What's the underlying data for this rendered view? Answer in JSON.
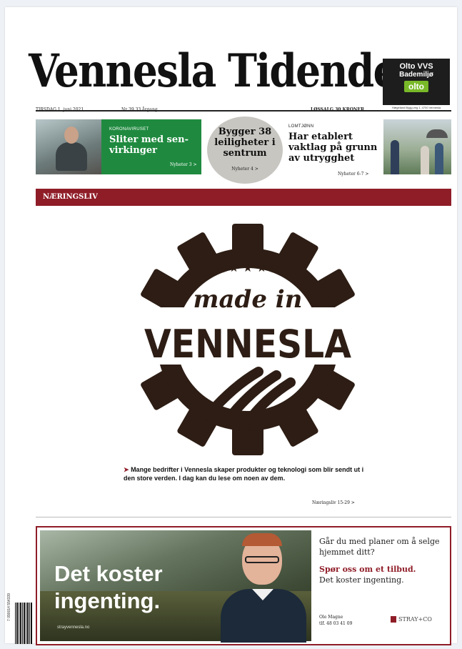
{
  "masthead": {
    "title": "Vennesla Tidende"
  },
  "dateline": {
    "day": "TIRSDAG 1. juni 2021",
    "issue": "Nr 39   33 årgang",
    "price": "LØSSALG 30 KRONER"
  },
  "top_ad": {
    "line1": "Olto VVS",
    "line2": "Bademiljø",
    "brand": "olto",
    "address": "Hægeland Bygg veg 1, 4700 Vennesla"
  },
  "teasers": {
    "left": {
      "kicker": "KORONAVIRUSET",
      "headline": "Sliter med sen-virkinger",
      "ref": "Nyheter 3 >"
    },
    "center": {
      "headline": "Bygger 38 leiligheter i sentrum",
      "ref": "Nyheter 4 >"
    },
    "right": {
      "kicker": "LOMTJØNN",
      "headline": "Har etablert vaktlag på grunn av utrygghet",
      "ref": "Nyheter 6-7 >"
    }
  },
  "section": {
    "label": "NÆRINGSLIV"
  },
  "logo": {
    "script": "made in",
    "word": "VENNESLA"
  },
  "lede": {
    "arrow": "➤",
    "text": "Mange bedrifter i Vennesla skaper produkter og teknologi som blir sendt ut i den store verden. I dag kan du lese om noen av dem.",
    "ref": "Næringsliv 15-29 >"
  },
  "ad": {
    "title_line1": "Det koster",
    "title_line2": "ingenting.",
    "url": "strayvennesla.no",
    "question": "Går du med planer om å selge hjemmet ditt?",
    "cta": "Spør oss om et tilbud.",
    "subline": "Det koster ingenting.",
    "name": "Ole Magne",
    "phone": "tlf. 48 03 41 09",
    "brand": "STRAY+CO"
  },
  "barcode": {
    "text": "7 090014 554339"
  },
  "colors": {
    "accent": "#8f1d28",
    "green": "#1f8a3f",
    "logo": "#2d1d14"
  }
}
